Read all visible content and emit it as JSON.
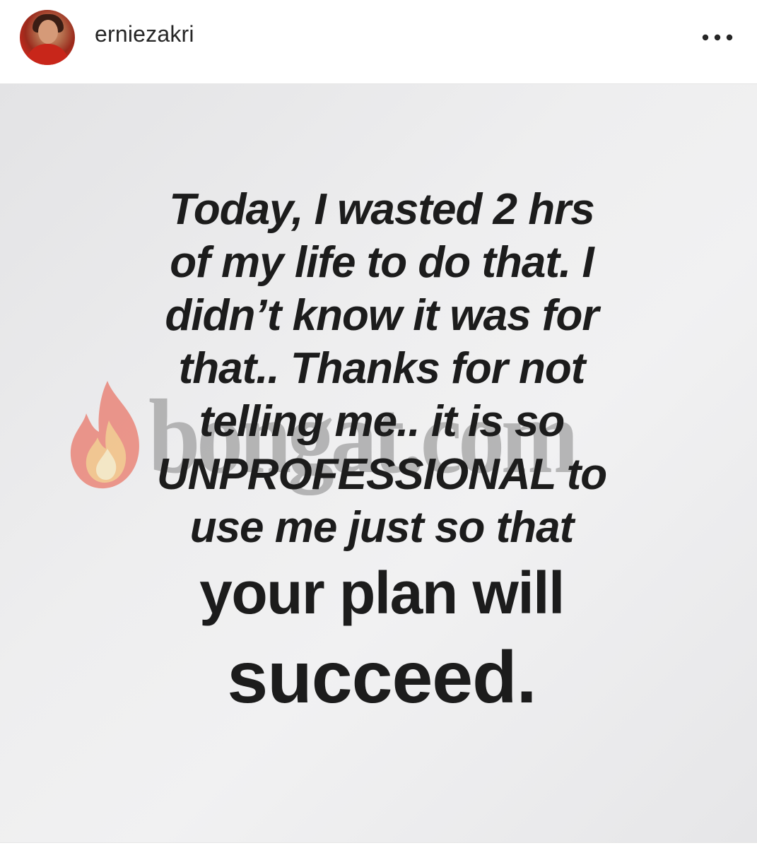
{
  "post": {
    "username": "erniezakri",
    "avatar_icon": "profile-photo",
    "more_icon": "more-horizontal-icon"
  },
  "image": {
    "watermark_text": "bongat.com",
    "watermark_icon": "flame-icon",
    "lines": [
      "Today, I wasted 2 hrs",
      "of my life to do that. I",
      "didn’t know it was for",
      "that.. Thanks for not",
      "telling me.. it is so",
      "UNPROFESSIONAL to",
      "use me just so that",
      "your plan will",
      "succeed."
    ]
  },
  "colors": {
    "text": "#1c1c1c",
    "username": "#262626",
    "background": "#eeeeef",
    "flame_outer": "#e9402a",
    "flame_inner": "#f6a23a"
  }
}
